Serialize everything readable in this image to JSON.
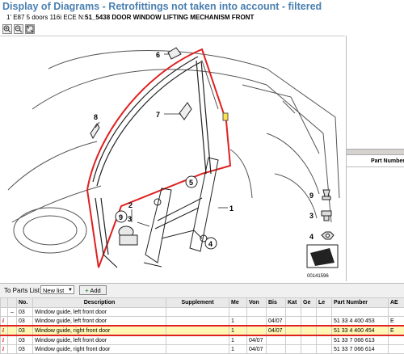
{
  "header": {
    "title": "Display of Diagrams - Retrofittings not taken into account - filtered",
    "subtitle_prefix": "1' E87 5 doors 116i ECE  N:",
    "subtitle_bold": "51_5438 DOOR WINDOW LIFTING MECHANISM FRONT"
  },
  "diagram": {
    "callouts": [
      "6",
      "7",
      "8",
      "5",
      "1",
      "2",
      "3",
      "4",
      "9"
    ],
    "image_number": "00141596",
    "legend_numbers": [
      "9",
      "3",
      "4"
    ]
  },
  "right_panel": {
    "col_part_number": "Part Number"
  },
  "toolbar": {
    "to_parts_list": "To Parts List",
    "list_select": "New list",
    "add_label": "Add"
  },
  "table": {
    "headers": [
      "",
      "",
      "No.",
      "Description",
      "Supplement",
      "Me",
      "Von",
      "Bis",
      "Kat",
      "Ge",
      "Le",
      "Part Number",
      "AE"
    ],
    "rows": [
      {
        "i": "",
        "exp": "–",
        "no": "03",
        "desc": "Window guide, left front door",
        "supp": "",
        "me": "",
        "von": "",
        "bis": "",
        "kat": "",
        "ge": "",
        "le": "",
        "pn": "",
        "ae": ""
      },
      {
        "i": "i",
        "exp": "",
        "no": "03",
        "desc": "Window guide, left front door",
        "supp": "",
        "me": "1",
        "von": "",
        "bis": "04/07",
        "kat": "",
        "ge": "",
        "le": "",
        "pn": "51 33 4 400 453",
        "ae": "E"
      },
      {
        "i": "i",
        "exp": "",
        "no": "03",
        "desc": "Window guide, right front door",
        "supp": "",
        "me": "1",
        "von": "",
        "bis": "04/07",
        "kat": "",
        "ge": "",
        "le": "",
        "pn": "51 33 4 400 454",
        "ae": "E"
      },
      {
        "i": "i",
        "exp": "",
        "no": "03",
        "desc": "Window guide, left front door",
        "supp": "",
        "me": "1",
        "von": "04/07",
        "bis": "",
        "kat": "",
        "ge": "",
        "le": "",
        "pn": "51 33 7 066 613",
        "ae": ""
      },
      {
        "i": "i",
        "exp": "",
        "no": "03",
        "desc": "Window guide, right front door",
        "supp": "",
        "me": "1",
        "von": "04/07",
        "bis": "",
        "kat": "",
        "ge": "",
        "le": "",
        "pn": "51 33 7 066 614",
        "ae": ""
      }
    ]
  }
}
